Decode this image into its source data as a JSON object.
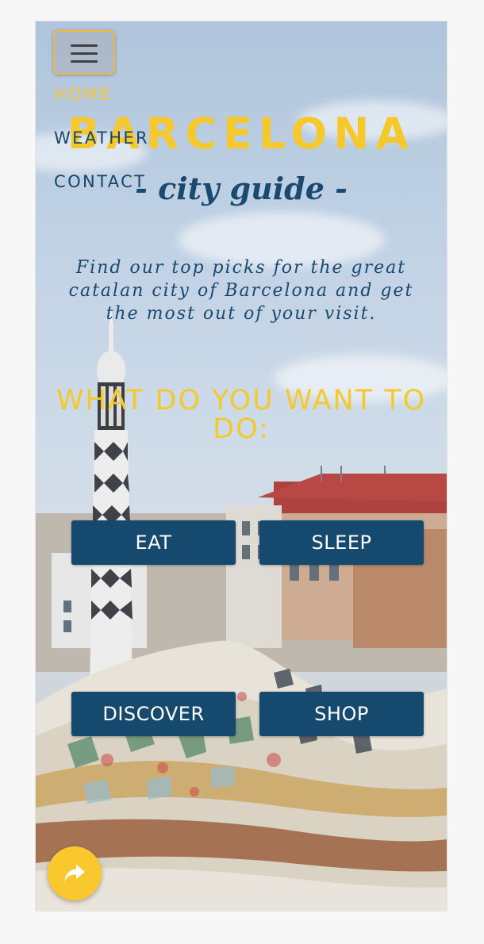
{
  "nav": {
    "toggle_icon": "hamburger-menu-icon",
    "items": [
      {
        "label": "HOME",
        "active": true
      },
      {
        "label": "WEATHER",
        "active": false
      },
      {
        "label": "CONTACT",
        "active": false
      }
    ]
  },
  "hero": {
    "title": "BARCELONA",
    "subtitle": "- city guide -",
    "intro": "Find our top picks for the great catalan city of Barcelona and get the most out of your visit.",
    "question": "WHAT DO YOU WANT TO DO:"
  },
  "actions": {
    "eat": "EAT",
    "sleep": "SLEEP",
    "discover": "DISCOVER",
    "shop": "SHOP"
  },
  "share_button": {
    "icon": "share-arrow-icon"
  },
  "colors": {
    "accent_yellow": "#f5c92e",
    "brand_blue": "#154a6e",
    "toggle_border": "#f1b73a"
  }
}
